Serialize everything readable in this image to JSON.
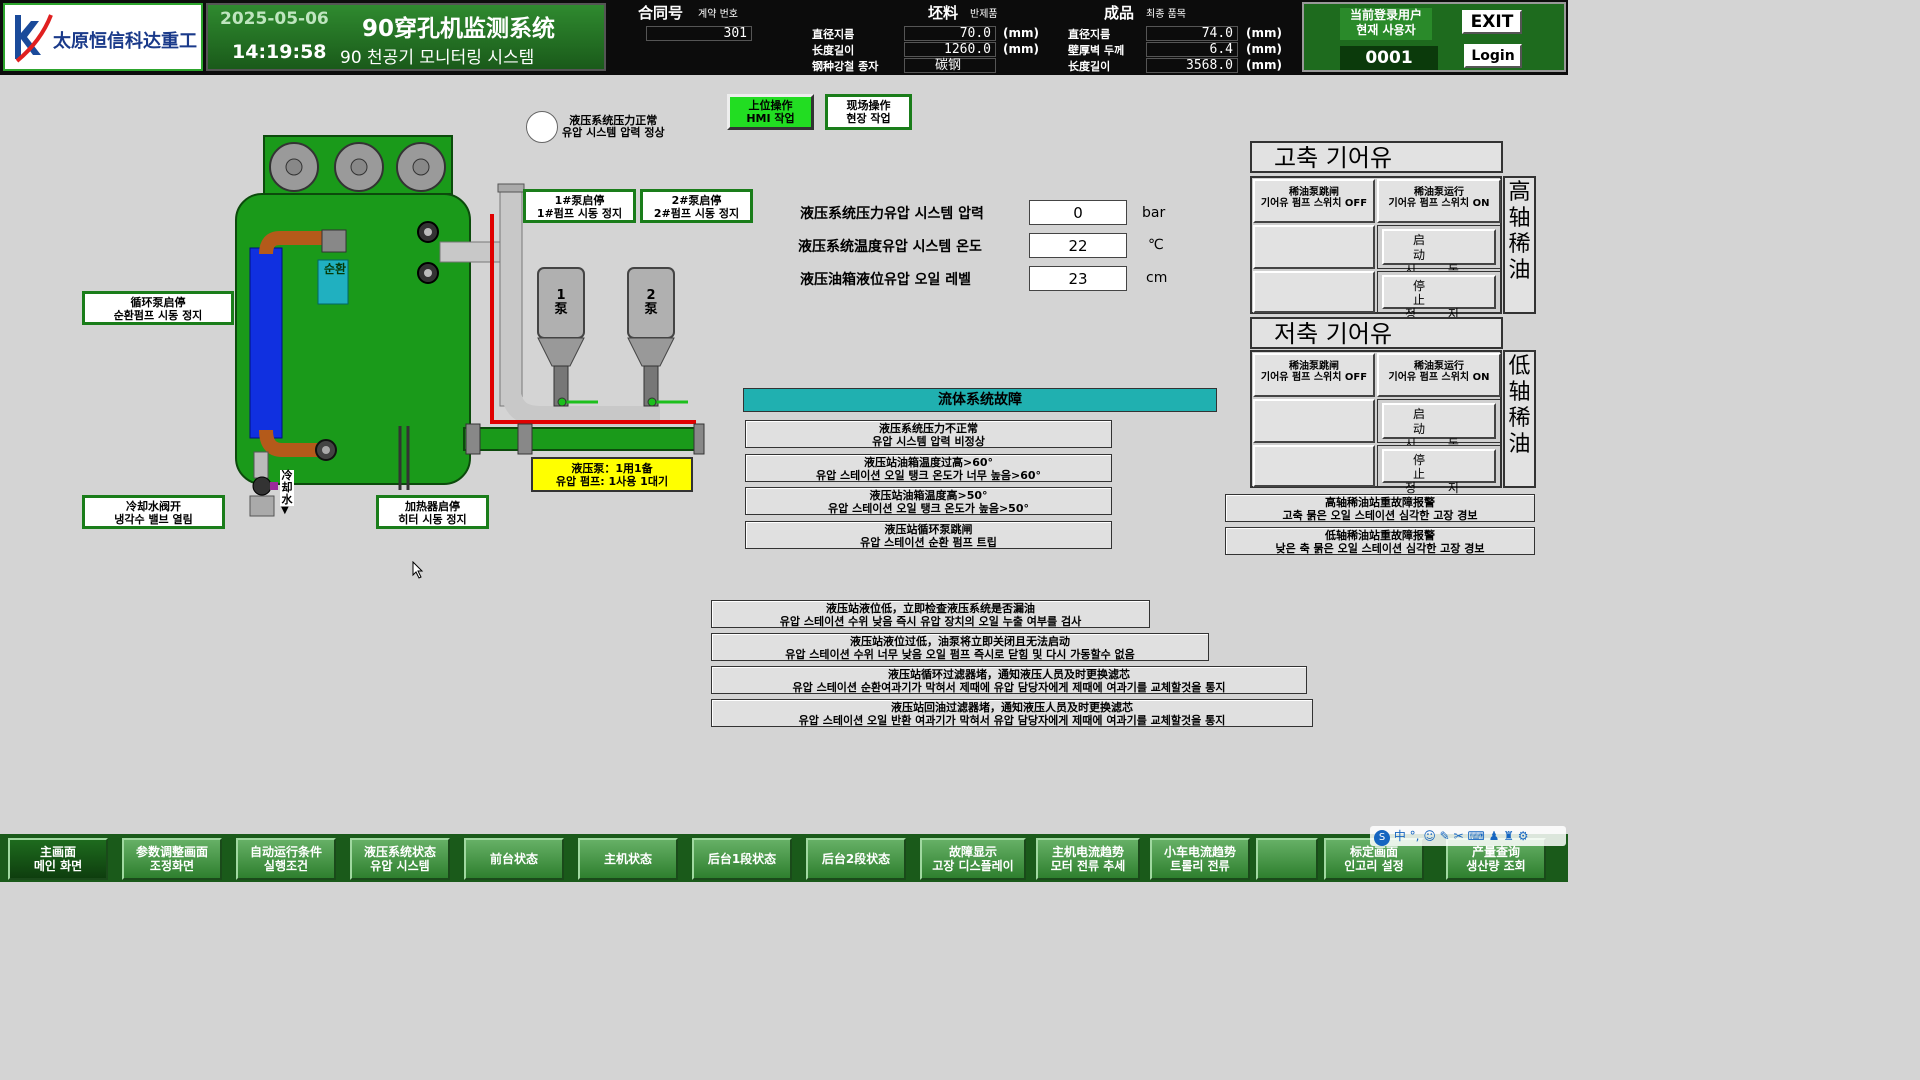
{
  "header": {
    "company": "太原恒信科达重工",
    "date": "2025-05-06",
    "time": "14:19:58",
    "system_title": "90穿孔机监测系统",
    "system_title_kr": "90 천공기 모니터링 시스템",
    "contract_label": "合同号",
    "contract_label_kr": "계약 번호",
    "contract_value": "301",
    "billet_label": "坯料",
    "billet_label_kr": "반제품",
    "product_label": "成品",
    "product_label_kr": "최종 품목",
    "billet": {
      "diameter_label": "直径지름",
      "diameter_value": "70.0",
      "length_label": "长度길이",
      "length_value": "1260.0",
      "steel_label": "钢种강철 종자",
      "steel_value": "碳钢",
      "unit": "(mm)"
    },
    "product": {
      "diameter_label": "直径지름",
      "diameter_value": "74.0",
      "wall_label": "壁厚벽 두께",
      "wall_value": "6.4",
      "length_label": "长度길이",
      "length_value": "3568.0",
      "unit": "(mm)"
    },
    "user_label_cn": "当前登录用户",
    "user_label_kr": "현재 사용자",
    "user_id": "0001",
    "exit_label": "EXIT",
    "login_label": "Login"
  },
  "mode": {
    "pressure_normal_cn": "液压系统压力正常",
    "pressure_normal_kr": "유압 시스템 압력 정상",
    "hmi_cn": "上位操作",
    "hmi_kr": "HMI 작업",
    "field_cn": "现场操作",
    "field_kr": "현장 작업"
  },
  "diagram": {
    "pump1_cn": "1#泵启停",
    "pump1_kr": "1#펌프 시동 정지",
    "pump2_cn": "2#泵启停",
    "pump2_kr": "2#펌프 시동 정지",
    "circ_pump_cn": "循环泵启停",
    "circ_pump_kr": "순환펌프 시동 정지",
    "circ_label": "순환",
    "pump1_tag": "1泵",
    "pump2_tag": "2泵",
    "cooling_valve_cn": "冷却水阀开",
    "cooling_valve_kr": "냉각수 밸브 열림",
    "cooling_water": "冷却水",
    "heater_cn": "加热器启停",
    "heater_kr": "히터 시동 정지",
    "pump_status_cn": "液压泵：1用1备",
    "pump_status_kr": "유압 펌프: 1사용 1대기"
  },
  "readings": [
    {
      "label": "液压系统压力유압 시스템 압력",
      "value": "0",
      "unit": "bar"
    },
    {
      "label": "液压系统温度유압 시스템 온도",
      "value": "22",
      "unit": "℃"
    },
    {
      "label": "液压油箱液位유압 오일 레벨",
      "value": "23",
      "unit": "cm"
    }
  ],
  "faults": {
    "header": "流体系统故障",
    "items": [
      {
        "cn": "液压系统压力不正常",
        "kr": "유압 시스템 압력 비정상"
      },
      {
        "cn": "液压站油箱温度过高>60°",
        "kr": "유압 스테이션 오일 탱크 온도가 너무 높음>60°"
      },
      {
        "cn": "液压站油箱温度高>50°",
        "kr": "유압 스테이션 오일 탱크 온도가 높음>50°"
      },
      {
        "cn": "液压站循环泵跳闸",
        "kr": "유압 스테이션 순환 펌프 트립"
      }
    ]
  },
  "messages": [
    {
      "cn": "液压站液位低，立即检查液压系统是否漏油",
      "kr": "유압 스테이션 수위 낮음 즉시 유압 장치의 오일 누출 여부를 검사"
    },
    {
      "cn": "液压站液位过低，油泵将立即关闭且无法启动",
      "kr": "유압 스테이션 수위 너무 낮음 오일 펌프 즉시로 닫힘 및 다시 가동할수 없음"
    },
    {
      "cn": "液压站循环过滤器堵，通知液压人员及时更换滤芯",
      "kr": "유압 스테이션 순환여과기가 막혀서 제때에 유압 담당자에게 제때에 여과기를 교체할것을 통지"
    },
    {
      "cn": "液压站回油过滤器堵，通知液压人员及时更换滤芯",
      "kr": "유압 스테이션 오일 반환 여과기가 막혀서 유압 담당자에게 제때에 여과기를 교체할것을 통지"
    }
  ],
  "lube_high": {
    "title": "고축 기어유",
    "side": "高轴稀油",
    "switch_off_cn": "稀油泵跳闸",
    "switch_off_kr": "기어유 펌프 스위치 OFF",
    "switch_on_cn": "稀油泵运行",
    "switch_on_kr": "기어유 펌프 스위치 ON",
    "start_cn": "启 动",
    "start_kr": "시 동",
    "stop_cn": "停 止",
    "stop_kr": "정 지"
  },
  "lube_low": {
    "title": "저축 기어유",
    "side": "低轴稀油",
    "switch_off_cn": "稀油泵跳闸",
    "switch_off_kr": "기어유 펌프 스위치 OFF",
    "switch_on_cn": "稀油泵运行",
    "switch_on_kr": "기어유 펌프 스위치 ON",
    "start_cn": "启 动",
    "start_kr": "시 동",
    "stop_cn": "停 止",
    "stop_kr": "정 지"
  },
  "lube_alarms": [
    {
      "cn": "高轴稀油站重故障报警",
      "kr": "고축 묽은 오일 스테이션 심각한 고장 경보"
    },
    {
      "cn": "低轴稀油站重故障报警",
      "kr": "낮은 축 묽은 오일 스테이션 심각한 고장 경보"
    }
  ],
  "nav": [
    {
      "cn": "主画面",
      "kr": "메인 화면"
    },
    {
      "cn": "参数调整画面",
      "kr": "조정화면"
    },
    {
      "cn": "自动运行条件",
      "kr": "실행조건"
    },
    {
      "cn": "液压系统状态",
      "kr": "유압 시스템"
    },
    {
      "cn": "前台状态",
      "kr": ""
    },
    {
      "cn": "主机状态",
      "kr": ""
    },
    {
      "cn": "后台1段状态",
      "kr": ""
    },
    {
      "cn": "后台2段状态",
      "kr": ""
    },
    {
      "cn": "故障显示",
      "kr": "고장 디스플레이"
    },
    {
      "cn": "主机电流趋势",
      "kr": "모터 전류 추세"
    },
    {
      "cn": "小车电流趋势",
      "kr": "트롤리 전류"
    },
    {
      "cn": "",
      "kr": ""
    },
    {
      "cn": "标定画面",
      "kr": "인고리 설정"
    },
    {
      "cn": "产量查询",
      "kr": "생산량 조회"
    }
  ],
  "colors": {
    "header_bg": "#0c0c0c",
    "panel_green": "#1e6b1e",
    "tank_green": "#1a9a1a",
    "fault_header": "#20b0b0",
    "pump_status_bg": "#ffff00",
    "pipe_red": "#e00000"
  }
}
